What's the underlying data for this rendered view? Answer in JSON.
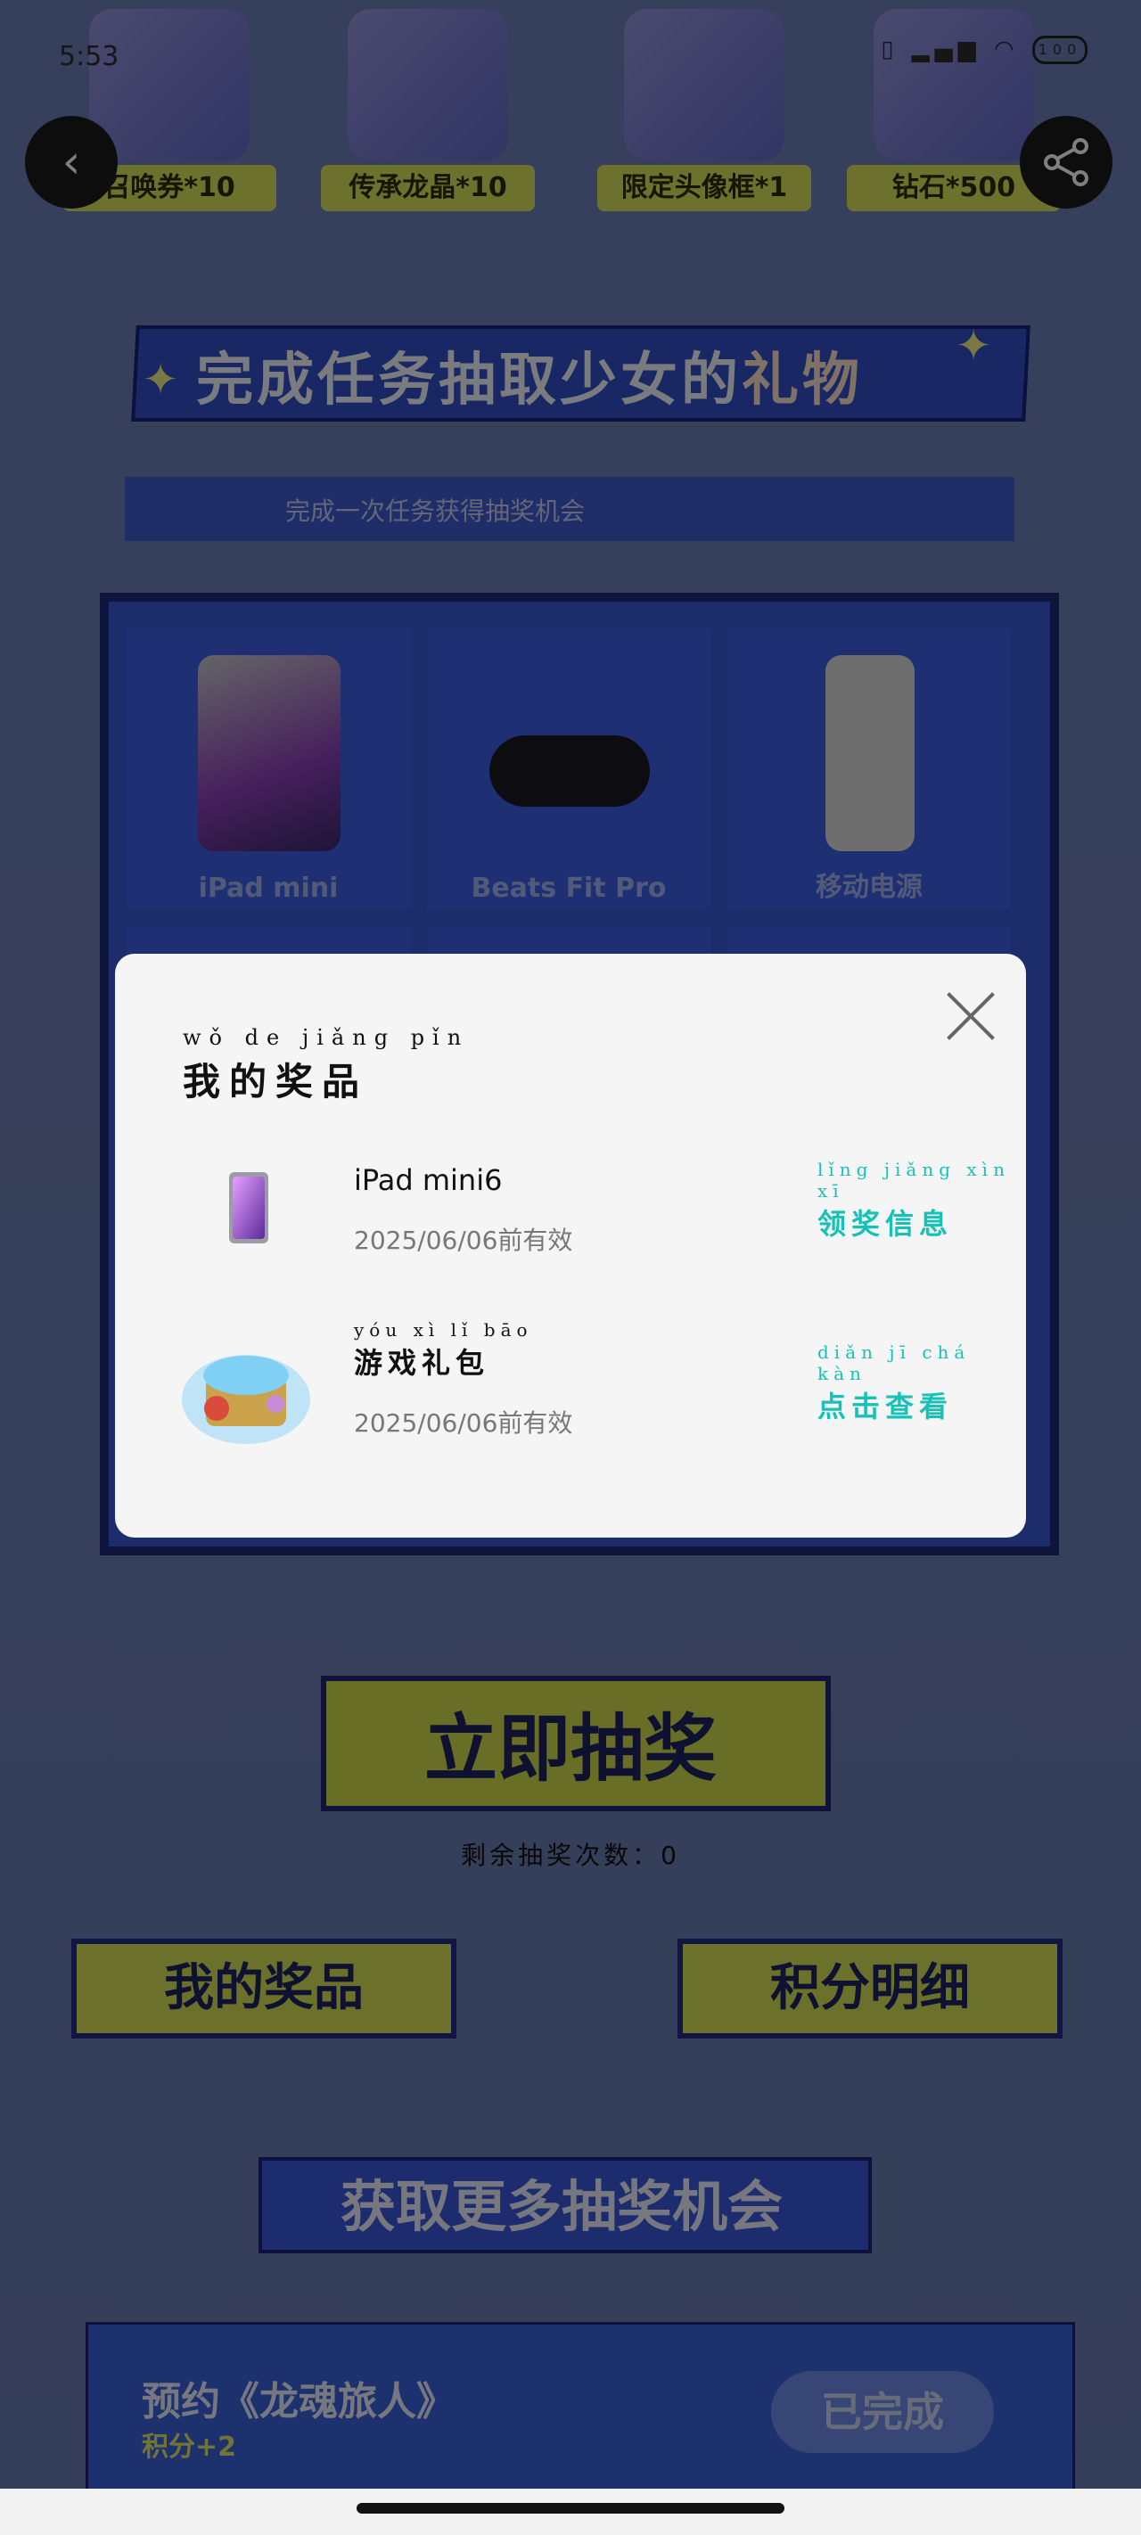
{
  "status_bar": {
    "time": "5:53",
    "right_icons": "▯ ▂▄▆ ◠",
    "battery": "100"
  },
  "rewards": [
    {
      "label": "召唤券*10"
    },
    {
      "label": "传承龙晶*10"
    },
    {
      "label": "限定头像框*1"
    },
    {
      "label": "钻石*500"
    }
  ],
  "nav": {
    "back_icon": "‹",
    "share_icon": "⤴"
  },
  "banner": {
    "title_main": "完成任务抽取少女的",
    "title_accent": "礼物",
    "subtitle": "完成一次任务获得抽奖机会"
  },
  "prizes": [
    {
      "name": "iPad mini"
    },
    {
      "name": "Beats Fit Pro"
    },
    {
      "name": "移动电源"
    }
  ],
  "draw": {
    "button": "立即抽奖",
    "remaining": "剩余抽奖次数：0"
  },
  "buttons": {
    "my_prizes": "我的奖品",
    "points_detail": "积分明细"
  },
  "more_chances": "获取更多抽奖机会",
  "task": {
    "title": "预约《龙魂旅人》",
    "points": "积分+2",
    "status": "已完成"
  },
  "modal": {
    "title_pinyin": "wǒ de jiǎng pǐn",
    "title": "我的奖品",
    "items": [
      {
        "name": "iPad mini6",
        "date": "2025/06/06前有效",
        "action_pinyin": "lǐng jiǎng xìn xī",
        "action": "领奖信息"
      },
      {
        "name_pinyin": "yóu xì lǐ bāo",
        "name": "游戏礼包",
        "date": "2025/06/06前有效",
        "action_pinyin": "diǎn jī chá kàn",
        "action": "点击查看"
      }
    ]
  }
}
